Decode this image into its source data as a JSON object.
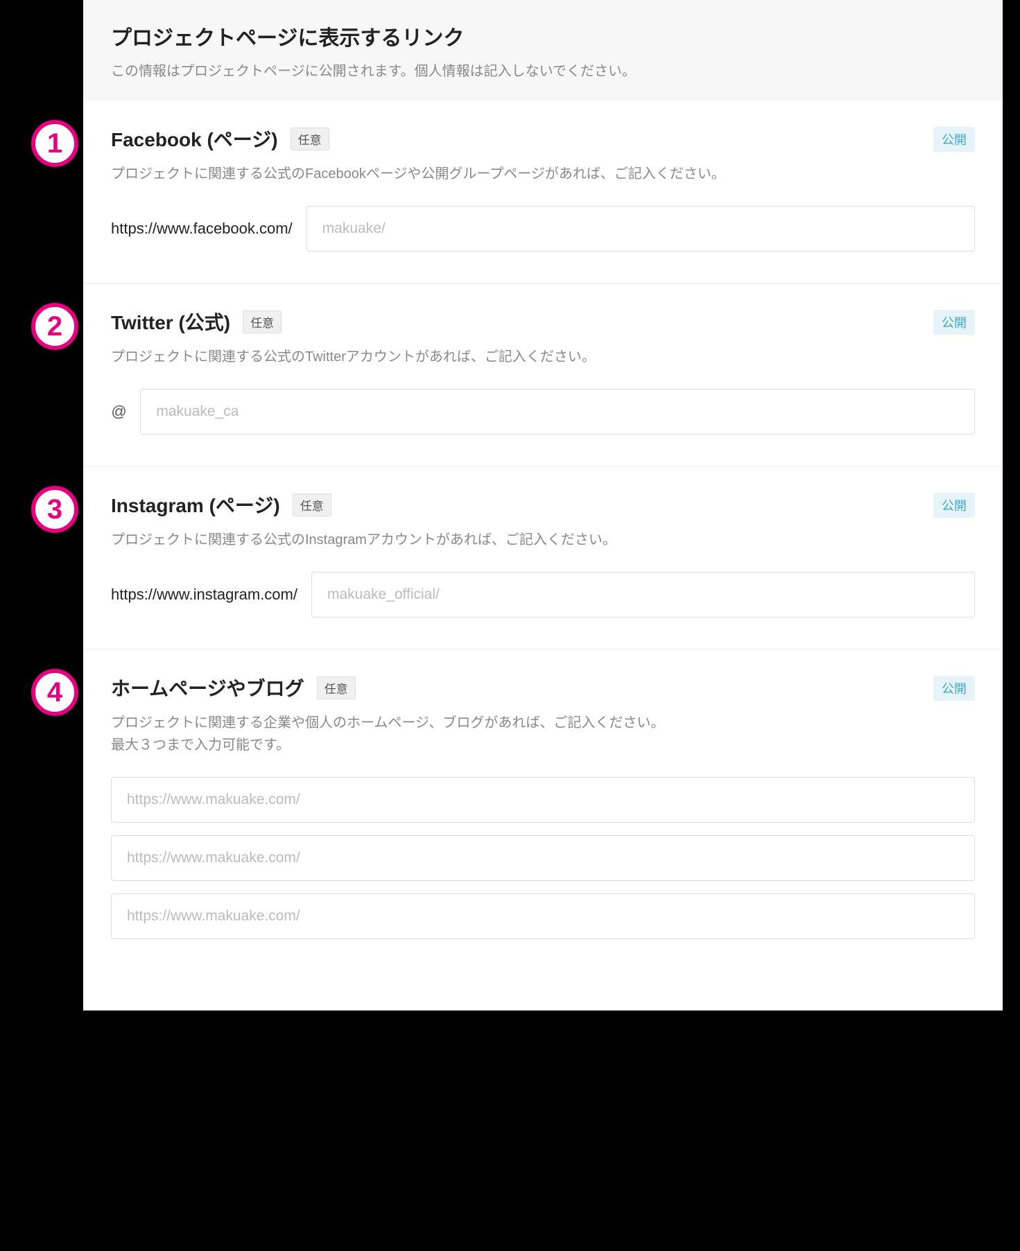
{
  "header": {
    "title": "プロジェクトページに表示するリンク",
    "subtitle": "この情報はプロジェクトページに公開されます。個人情報は記入しないでください。"
  },
  "common": {
    "optional_label": "任意",
    "public_label": "公開"
  },
  "circles": {
    "one": "1",
    "two": "2",
    "three": "3",
    "four": "4"
  },
  "sections": {
    "facebook": {
      "title": "Facebook (ページ)",
      "desc": "プロジェクトに関連する公式のFacebookページや公開グループページがあれば、ご記入ください。",
      "prefix": "https://www.facebook.com/",
      "placeholder": "makuake/"
    },
    "twitter": {
      "title": "Twitter (公式)",
      "desc": "プロジェクトに関連する公式のTwitterアカウントがあれば、ご記入ください。",
      "prefix": "@",
      "placeholder": "makuake_ca"
    },
    "instagram": {
      "title": "Instagram (ページ)",
      "desc": "プロジェクトに関連する公式のInstagramアカウントがあれば、ご記入ください。",
      "prefix": "https://www.instagram.com/",
      "placeholder": "makuake_official/"
    },
    "homepage": {
      "title": "ホームページやブログ",
      "desc": "プロジェクトに関連する企業や個人のホームページ、ブログがあれば、ご記入ください。\n最大３つまで入力可能です。",
      "placeholder1": "https://www.makuake.com/",
      "placeholder2": "https://www.makuake.com/",
      "placeholder3": "https://www.makuake.com/"
    }
  }
}
